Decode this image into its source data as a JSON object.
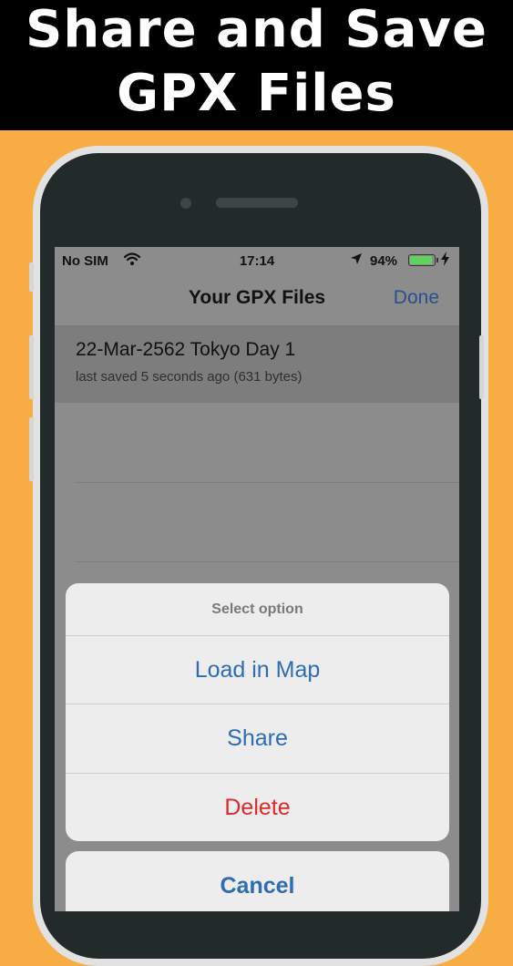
{
  "banner": {
    "line1": "Share and Save",
    "line2": "GPX Files"
  },
  "status": {
    "carrier": "No SIM",
    "time": "17:14",
    "battery": "94%"
  },
  "navbar": {
    "title": "Your GPX Files",
    "done": "Done"
  },
  "files": [
    {
      "name": "22-Mar-2562 Tokyo Day 1",
      "meta": "last saved 5 seconds ago (631 bytes)"
    }
  ],
  "sheet": {
    "header": "Select option",
    "options": [
      "Load in Map",
      "Share",
      "Delete"
    ],
    "cancel": "Cancel"
  },
  "colors": {
    "accent": "#2e6db2",
    "destructive": "#dc2a2a",
    "background": "#f8ad44",
    "banner": "#000000"
  },
  "icons": [
    "wifi-icon",
    "location-arrow-icon",
    "battery-icon",
    "charging-bolt-icon"
  ]
}
